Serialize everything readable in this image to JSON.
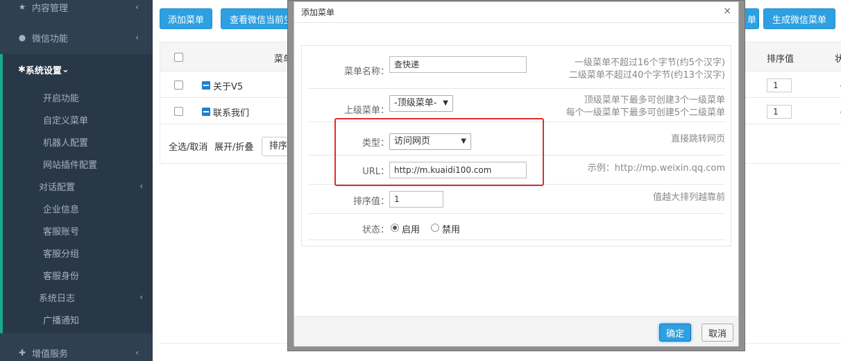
{
  "sidebar": {
    "content_mgmt": "内容管理",
    "wechat": "微信功能",
    "system": "系统设置",
    "sub_items": [
      "开启功能",
      "自定义菜单",
      "机器人配置",
      "网站插件配置"
    ],
    "dialog_cfg": "对话配置",
    "dialog_items": [
      "企业信息",
      "客服账号",
      "客服分组",
      "客服身份"
    ],
    "syslog": "系统日志",
    "broadcast": "广播通知",
    "value_service": "增值服务"
  },
  "toolbar": {
    "add_menu": "添加菜单",
    "view_current": "查看微信当前生",
    "right_partial": "单",
    "generate": "生成微信菜单"
  },
  "table": {
    "col_menu": "菜单",
    "col_sort": "排序值",
    "col_status": "状",
    "rows": [
      {
        "name": "关于V5",
        "sort": "1"
      },
      {
        "name": "联系我们",
        "sort": "1"
      }
    ],
    "select_all": "全选/取消",
    "expand": "展开/折叠",
    "sort_btn": "排序"
  },
  "dialog": {
    "title": "添加菜单",
    "close": "×",
    "name_label": "菜单名称：",
    "name_value": "查快递",
    "name_hint1": "一级菜单不超过16个字节(约5个汉字)",
    "name_hint2": "二级菜单不超过40个字节(约13个汉字)",
    "parent_label": "上级菜单：",
    "parent_value": "-顶级菜单-",
    "parent_hint1": "顶级菜单下最多可创建3个一级菜单",
    "parent_hint2": "每个一级菜单下最多可创建5个二级菜单",
    "type_label": "类型：",
    "type_value": "访问网页",
    "type_hint": "直接跳转网页",
    "url_label": "URL：",
    "url_value": "http://m.kuaidi100.com",
    "url_hint": "示例：http://mp.weixin.qq.com",
    "sort_label": "排序值：",
    "sort_value": "1",
    "sort_hint": "值越大排列越靠前",
    "status_label": "状态：",
    "status_on": "启用",
    "status_off": "禁用",
    "ok": "确定",
    "cancel": "取消"
  }
}
